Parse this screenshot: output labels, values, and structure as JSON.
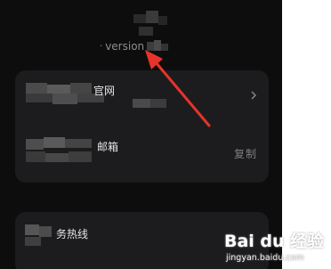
{
  "header": {
    "version_label": "version"
  },
  "settings_card": {
    "website_row": {
      "label_suffix": "官网",
      "chevron_icon": "chevron-right-icon"
    },
    "email_row": {
      "label_suffix": "邮箱",
      "copy_label": "复制"
    }
  },
  "hotline_card": {
    "label_suffix": "务热线"
  },
  "annotation": {
    "arrow_color": "#e8332a"
  },
  "watermark": {
    "brand": "Bai du 经验",
    "url": "jingyan.baidu.com"
  },
  "colors": {
    "screen_bg": "#0d0d0d",
    "card_bg": "#1c1c1e",
    "label_text": "#e6e6e6",
    "secondary_text": "#8e8e8e"
  }
}
